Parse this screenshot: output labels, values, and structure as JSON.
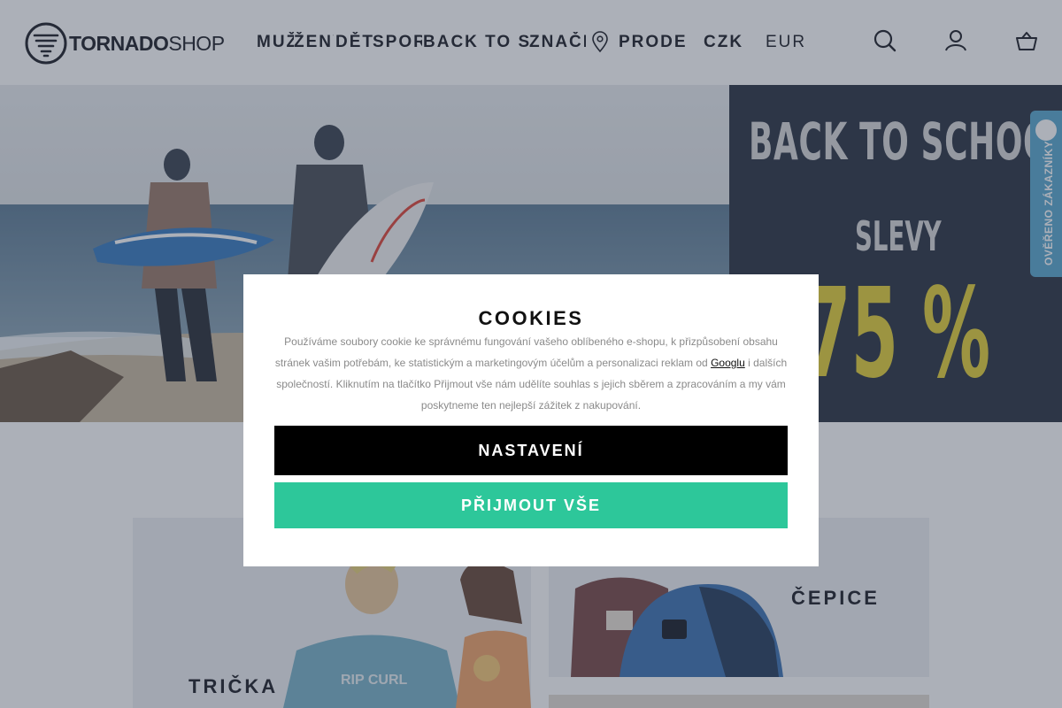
{
  "header": {
    "logo": {
      "bold": "TORNADO",
      "light": "SHOP"
    },
    "nav": [
      {
        "label": "MUŽI"
      },
      {
        "label": "ŽENY"
      },
      {
        "label": "DĚTI"
      },
      {
        "label": "SPORT"
      },
      {
        "label": "BACK TO SCHOOL"
      },
      {
        "label": "ZNAČKY"
      },
      {
        "label": "PRODEJNY"
      }
    ],
    "currency": [
      {
        "label": "CZK",
        "selected": true
      },
      {
        "label": "EUR",
        "selected": false
      }
    ],
    "icons": [
      "search-icon",
      "user-icon",
      "basket-icon"
    ]
  },
  "hero": {
    "promo_title": "BACK TO SCHOOL",
    "promo_subtitle": "SLEVY",
    "promo_percent": "75 %"
  },
  "verified_badge": {
    "label": "OVĚŘENO ZÁKAZNÍKY",
    "color": "#5aa8cf"
  },
  "categories": [
    {
      "label": "TRIČKA"
    },
    {
      "label": "ČEPICE"
    }
  ],
  "cookie_modal": {
    "title": "COOKIES",
    "text_before": "Používáme soubory cookie ke správnému fungování vašeho oblíbeného e-shopu, k přizpůsobení obsahu stránek vašim potřebám, ke statistickým a marketingovým účelům a personalizaci reklam od",
    "link": "Googlu",
    "text_after": "i dalších společností. Kliknutím na tlačítko Přijmout vše nám udělíte souhlas s jejich sběrem a zpracováním a my vám poskytneme ten nejlepší zážitek z nakupování.",
    "settings_label": "NASTAVENÍ",
    "accept_label": "PŘIJMOUT VŠE"
  },
  "colors": {
    "accent": "#2dc79a",
    "promo_bg": "#2c3444",
    "promo_yellow": "#e5d13a",
    "text_dark": "#1e2128"
  }
}
